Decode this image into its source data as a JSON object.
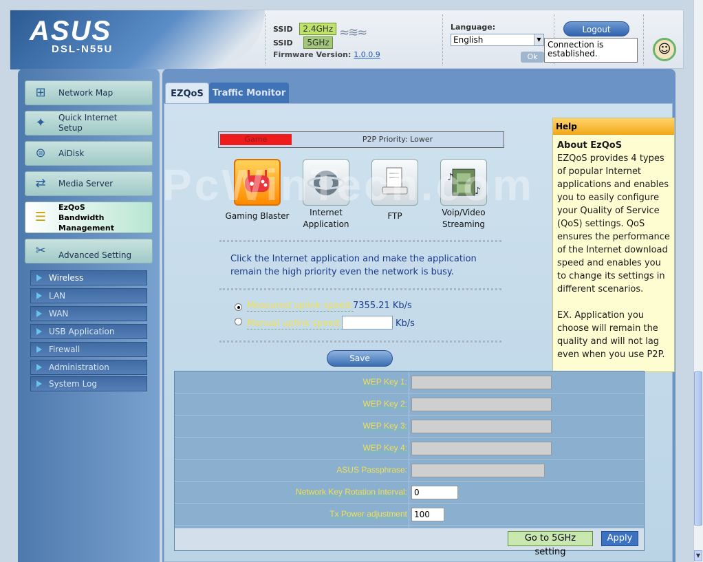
{
  "header": {
    "brand": "ASUS",
    "model": "DSL-N55U",
    "ssid_label": "SSID",
    "band_24": "2.4GHz",
    "band_5": "5GHz",
    "firmware_label": "Firmware Version:",
    "firmware_version": "1.0.0.9",
    "language_label": "Language:",
    "language_value": "English",
    "ok_label": "Ok",
    "logout_label": "Logout",
    "tooltip": "Connection is established."
  },
  "sidebar": {
    "items": [
      {
        "label": "Network Map",
        "icon": "network-map-icon"
      },
      {
        "label": "Quick Internet Setup",
        "icon": "wand-icon"
      },
      {
        "label": "AiDisk",
        "icon": "disk-icon"
      },
      {
        "label": "Media Server",
        "icon": "media-server-icon"
      },
      {
        "label": "EzQoS Bandwidth Management",
        "icon": "qos-icon"
      },
      {
        "label": "Advanced Setting",
        "icon": "tools-icon"
      }
    ],
    "sub_items": [
      "Wireless",
      "LAN",
      "WAN",
      "USB Application",
      "Firewall",
      "Administration",
      "System Log"
    ]
  },
  "tabs": {
    "ezqos": "EZQoS",
    "traffic": "Traffic Monitor"
  },
  "ezqos": {
    "priority_game": "Game",
    "priority_text": "P2P Priority: Lower",
    "apps": [
      {
        "label": "Gaming Blaster"
      },
      {
        "label": "Internet Application"
      },
      {
        "label": "FTP"
      },
      {
        "label": "Voip/Video Streaming"
      }
    ],
    "instruction": "Click the Internet application and make the application remain the high priority even the network is busy.",
    "measured_label": "Measured uplink speed:",
    "measured_value": "7355.21 Kb/s",
    "manual_label": "Manual uplink speed:",
    "manual_unit": "Kb/s",
    "save_label": "Save"
  },
  "help": {
    "heading": "Help",
    "title": "About EzQoS",
    "body": "EZQoS provides 4 types of popular Internet applications and enables you to easily configure your Quality of Service (QoS) settings. QoS ensures the performance of the Internet download speed and enables you to change its settings in different scenarios.",
    "example": "EX. Application you choose will remain the quality and will not lag even when you use P2P."
  },
  "wep": {
    "rows": [
      {
        "label": "WEP Key 1:",
        "value": ""
      },
      {
        "label": "WEP Key 2:",
        "value": ""
      },
      {
        "label": "WEP Key 3:",
        "value": ""
      },
      {
        "label": "WEP Key 4:",
        "value": ""
      },
      {
        "label": "ASUS Passphrase:",
        "value": ""
      },
      {
        "label": "Network Key Rotation Interval:",
        "value": "0"
      },
      {
        "label": "Tx Power adjustment",
        "value": "100"
      }
    ],
    "btn_5g": "Go to 5GHz setting",
    "btn_apply": "Apply"
  },
  "watermark": "PcWinTech.com"
}
